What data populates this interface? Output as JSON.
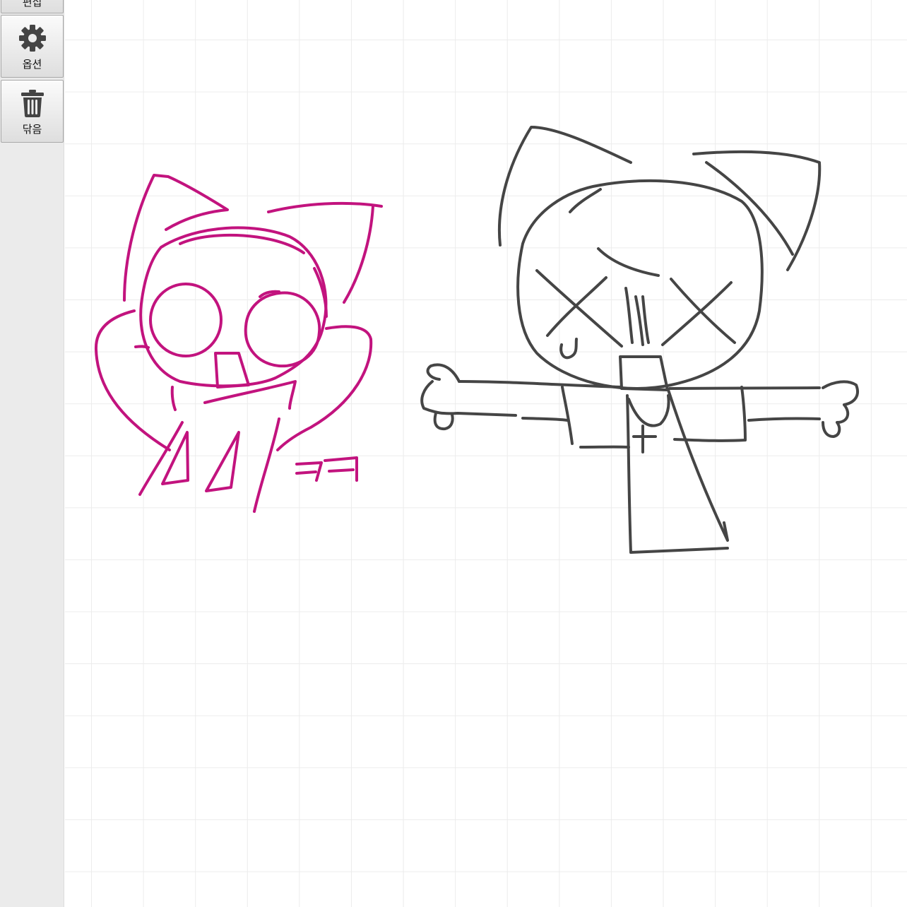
{
  "toolbar": {
    "top_button_label": "편집",
    "options_label": "옵션",
    "options_icon": "gear-icon",
    "clear_label": "닦음",
    "clear_icon": "trash-icon"
  },
  "canvas": {
    "grid": true,
    "grid_color": "#ececec",
    "background": "#ffffff"
  },
  "drawings": [
    {
      "name": "magenta-cat-doodle",
      "color": "#c2137e",
      "handwritten_text": "ㅋㅋ"
    },
    {
      "name": "gray-cat-doodle",
      "color": "#454545"
    }
  ]
}
